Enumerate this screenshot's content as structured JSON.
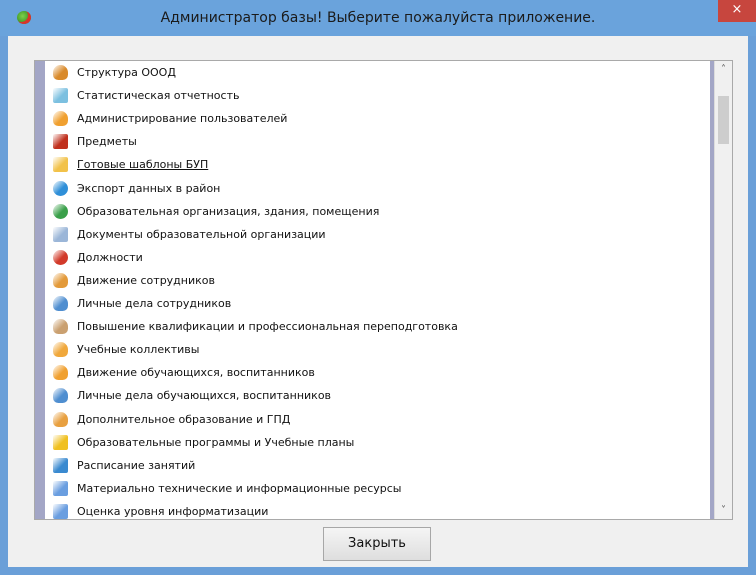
{
  "window": {
    "title": "Администратор базы! Выберите пожалуйста приложение.",
    "close_glyph": "×"
  },
  "list": {
    "items": [
      {
        "label": "Структура ОООД",
        "icon": "people-icon",
        "color": "#d98a2b"
      },
      {
        "label": "Статистическая отчетность",
        "icon": "report-icon",
        "color": "#7cc0e0"
      },
      {
        "label": "Администрирование пользователей",
        "icon": "user-icon",
        "color": "#f0a030"
      },
      {
        "label": "Предметы",
        "icon": "board-icon",
        "color": "#c0301d"
      },
      {
        "label": "Готовые шаблоны БУП",
        "icon": "folder-icon",
        "color": "#f2c24a",
        "underlined": true
      },
      {
        "label": "Экспорт данных в район",
        "icon": "export-icon",
        "color": "#2f8fd8"
      },
      {
        "label": "Образовательная организация, здания, помещения",
        "icon": "building-icon",
        "color": "#3aa04a"
      },
      {
        "label": "Документы образовательной организации",
        "icon": "documents-icon",
        "color": "#9bb6d8"
      },
      {
        "label": "Должности",
        "icon": "position-icon",
        "color": "#d23a2a"
      },
      {
        "label": "Движение сотрудников",
        "icon": "employee-move-icon",
        "color": "#e39a3a"
      },
      {
        "label": "Личные дела сотрудников",
        "icon": "employee-files-icon",
        "color": "#4f8ed0"
      },
      {
        "label": "Повышение квалификации и профессиональная переподготовка",
        "icon": "training-icon",
        "color": "#caa070"
      },
      {
        "label": "Учебные коллективы",
        "icon": "groups-icon",
        "color": "#f0a83c"
      },
      {
        "label": "Движение обучающихся, воспитанников",
        "icon": "student-move-icon",
        "color": "#f0a030"
      },
      {
        "label": "Личные дела обучающихся, воспитанников",
        "icon": "student-files-icon",
        "color": "#4f8ed0"
      },
      {
        "label": "Дополнительное образование и ГПД",
        "icon": "extra-education-icon",
        "color": "#e8a040"
      },
      {
        "label": "Образовательные программы и Учебные планы",
        "icon": "programs-icon",
        "color": "#f0c020"
      },
      {
        "label": "Расписание занятий",
        "icon": "schedule-icon",
        "color": "#3a8ad0"
      },
      {
        "label": "Материально технические и информационные ресурсы",
        "icon": "resources-icon",
        "color": "#6a9ee0"
      },
      {
        "label": "Оценка уровня информатизации",
        "icon": "informatization-icon",
        "color": "#6a9ee0"
      }
    ]
  },
  "buttons": {
    "close_label": "Закрыть"
  },
  "scrollbar": {
    "up_glyph": "˄",
    "down_glyph": "˅"
  }
}
